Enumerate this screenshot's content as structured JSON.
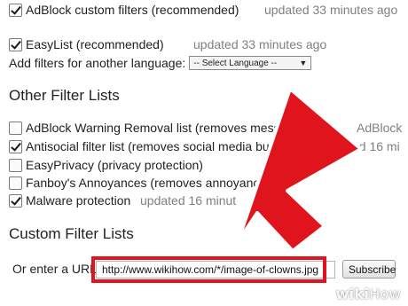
{
  "filters": [
    {
      "label": "AdBlock custom filters (recommended)",
      "checked": true,
      "updated": "updated 33 minutes ago"
    },
    {
      "label": "EasyList (recommended)",
      "checked": true,
      "updated": "updated 33 minutes ago"
    }
  ],
  "language": {
    "label": "Add filters for another language:",
    "selected": "-- Select Language --"
  },
  "other_section": {
    "title": "Other Filter Lists",
    "items": [
      {
        "label": "AdBlock Warning Removal list (removes messa",
        "checked": false,
        "updated": "AdBlock"
      },
      {
        "label": "Antisocial filter list (removes social media butto",
        "checked": true,
        "updated": "ed 16 mi"
      },
      {
        "label": "EasyPrivacy (privacy protection)",
        "checked": false,
        "updated": ""
      },
      {
        "label": "Fanboy's Annoyances (removes annoyance",
        "checked": false,
        "updated": ""
      },
      {
        "label": "Malware protection",
        "checked": true,
        "updated": "updated 16 minut"
      }
    ]
  },
  "custom_section": {
    "title": "Custom Filter Lists",
    "url_label": "Or enter a URL:",
    "url_value": "http://www.wikihow.com/*/image-of-clowns.jpg",
    "subscribe_label": "Subscribe"
  },
  "annotation": {
    "arrow_color": "#e0141c"
  },
  "watermark": {
    "prefix": "wiki",
    "suffix": "How"
  }
}
